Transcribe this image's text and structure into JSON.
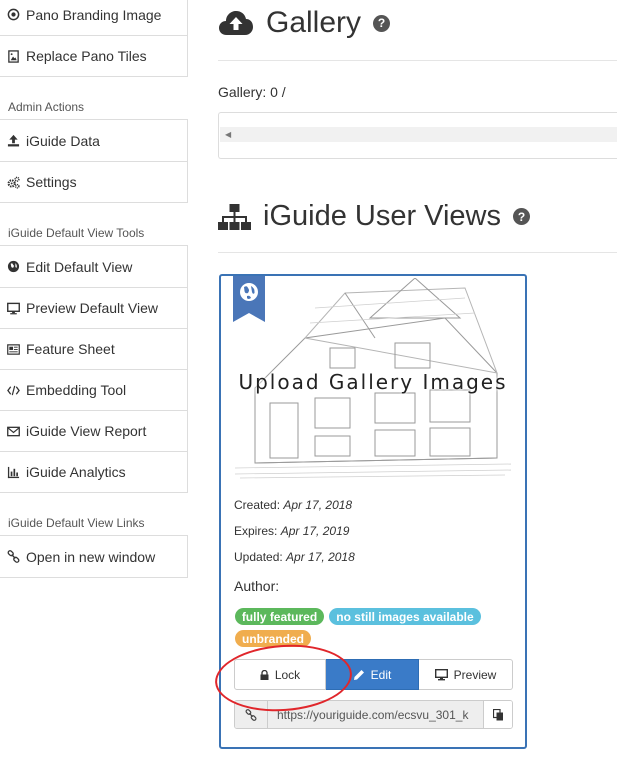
{
  "sidebar": {
    "top_items": [
      {
        "label": "Pano Branding Image",
        "icon": "dot-circle-icon"
      },
      {
        "label": "Replace Pano Tiles",
        "icon": "image-file-icon"
      }
    ],
    "admin_heading": "Admin Actions",
    "admin_items": [
      {
        "label": "iGuide Data",
        "icon": "upload-icon"
      },
      {
        "label": "Settings",
        "icon": "cogs-icon"
      }
    ],
    "tools_heading": "iGuide Default View Tools",
    "tools_items": [
      {
        "label": "Edit Default View",
        "icon": "globe-icon"
      },
      {
        "label": "Preview Default View",
        "icon": "desktop-icon"
      },
      {
        "label": "Feature Sheet",
        "icon": "newspaper-icon"
      },
      {
        "label": "Embedding Tool",
        "icon": "code-icon"
      },
      {
        "label": "iGuide View Report",
        "icon": "envelope-icon"
      },
      {
        "label": "iGuide Analytics",
        "icon": "bar-chart-icon"
      }
    ],
    "links_heading": "iGuide Default View Links",
    "links_items": [
      {
        "label": "Open in new window",
        "icon": "link-icon"
      }
    ]
  },
  "gallery": {
    "title": "Gallery",
    "help": "?",
    "count_label": "Gallery: 0 /"
  },
  "user_views": {
    "title": "iGuide User Views",
    "help": "?",
    "card": {
      "thumb_text": "Upload Gallery Images",
      "created_label": "Created:",
      "created_value": "Apr 17, 2018",
      "expires_label": "Expires:",
      "expires_value": "Apr 17, 2019",
      "updated_label": "Updated:",
      "updated_value": "Apr 17, 2018",
      "author_label": "Author:",
      "badges": [
        {
          "label": "fully featured",
          "color": "#5cb85c"
        },
        {
          "label": "no still images available",
          "color": "#5bc0de"
        },
        {
          "label": "unbranded",
          "color": "#f0ad4e"
        }
      ],
      "buttons": {
        "lock": "Lock",
        "edit": "Edit",
        "preview": "Preview"
      },
      "url": "https://youriguide.com/ecsvu_301_k"
    }
  },
  "colors": {
    "card_border": "#3a73b5",
    "primary": "#3a7bc8",
    "annotation": "#e0262b"
  }
}
